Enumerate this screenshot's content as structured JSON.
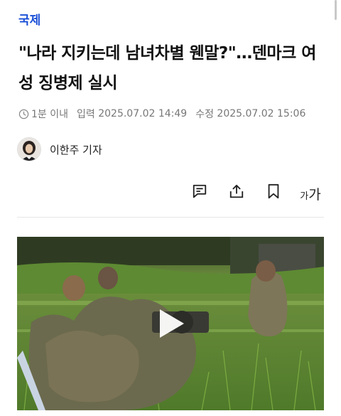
{
  "article": {
    "category": "국제",
    "headline": "\"나라 지키는데 남녀차별 웬말?\"…덴마크 여성 징병제 실시",
    "read_time": "1분 이내",
    "published_label": "입력",
    "published_time": "2025.07.02 14:49",
    "modified_label": "수정",
    "modified_time": "2025.07.02 15:06",
    "author": "이한주 기자"
  },
  "toolbar": {
    "icons": [
      "comment-icon",
      "share-icon",
      "bookmark-icon",
      "font-size-icon"
    ],
    "font_small": "가",
    "font_big": "가"
  },
  "media": {
    "type": "video",
    "icon": "play-icon"
  },
  "colors": {
    "category": "#1a4fd6",
    "meta": "#777777"
  }
}
